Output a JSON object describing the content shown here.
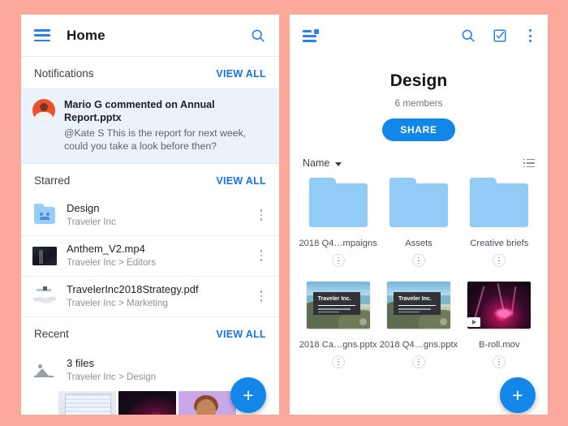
{
  "theme": {
    "page_background": "#faa99a",
    "accent_blue": "#1387e8",
    "link_blue": "#1a73e8",
    "folder_blue": "#93cbf7",
    "notification_card_bg": "#eaf2fa",
    "avatar_color": "#f0502c"
  },
  "left_panel": {
    "appbar": {
      "menu_icon": "hamburger-icon",
      "title": "Home",
      "search_icon": "search-icon"
    },
    "sections": {
      "notifications": {
        "title": "Notifications",
        "action": "VIEW ALL"
      },
      "starred": {
        "title": "Starred",
        "action": "VIEW ALL"
      },
      "recent": {
        "title": "Recent",
        "action": "VIEW ALL"
      }
    },
    "notification": {
      "avatar_name": "avatar-mario-g",
      "title": "Mario G commented on Annual Report.pptx",
      "body": "@Kate S This is the report for next week, could you take a look before then?"
    },
    "starred_items": [
      {
        "icon": "shared-folder-icon",
        "name": "Design",
        "sub": "Traveler Inc",
        "menu": "kebab-menu-icon"
      },
      {
        "icon": "video-thumbnail-icon",
        "name": "Anthem_V2.mp4",
        "sub": "Traveler Inc > Editors",
        "menu": "kebab-menu-icon"
      },
      {
        "icon": "pdf-thumbnail-icon",
        "name": "TravelerInc2018Strategy.pdf",
        "sub": "Traveler Inc > Marketing",
        "menu": "kebab-menu-icon"
      }
    ],
    "recent_item": {
      "icon": "image-stack-icon",
      "name": "3 files",
      "sub": "Traveler Inc > Design"
    },
    "recent_thumbnails": [
      {
        "name": "thumbnail-laptop"
      },
      {
        "name": "thumbnail-concert"
      },
      {
        "name": "thumbnail-portrait"
      }
    ],
    "fab": {
      "label": "+",
      "name": "add-button"
    }
  },
  "right_panel": {
    "appbar": {
      "menu_icon": "list-menu-badge-icon",
      "search_icon": "search-icon",
      "select_icon": "checkbox-select-icon",
      "overflow_icon": "overflow-menu-icon"
    },
    "header": {
      "title": "Design",
      "members": "6 members",
      "share_label": "SHARE"
    },
    "sortbar": {
      "sort_label": "Name",
      "caret_icon": "chevron-down-icon",
      "view_icon": "list-view-icon"
    },
    "folders": [
      {
        "thumb": "folder-icon",
        "label": "2018 Q4…mpaigns",
        "menu": "item-kebab-menu-icon"
      },
      {
        "thumb": "folder-icon",
        "label": "Assets",
        "menu": "item-kebab-menu-icon"
      },
      {
        "thumb": "folder-icon",
        "label": "Creative briefs",
        "menu": "item-kebab-menu-icon"
      }
    ],
    "files": [
      {
        "thumb": "pptx-slide-thumbnail",
        "slide_title": "Traveler Inc.",
        "label": "2018 Ca…gns.pptx",
        "menu": "item-kebab-menu-icon"
      },
      {
        "thumb": "pptx-slide-thumbnail",
        "slide_title": "Traveler Inc.",
        "label": "2018 Q4…gns.pptx",
        "menu": "item-kebab-menu-icon"
      },
      {
        "thumb": "video-thumbnail",
        "slide_title": "",
        "label": "B-roll.mov",
        "menu": "item-kebab-menu-icon"
      }
    ],
    "fab": {
      "label": "+",
      "name": "add-button"
    }
  }
}
